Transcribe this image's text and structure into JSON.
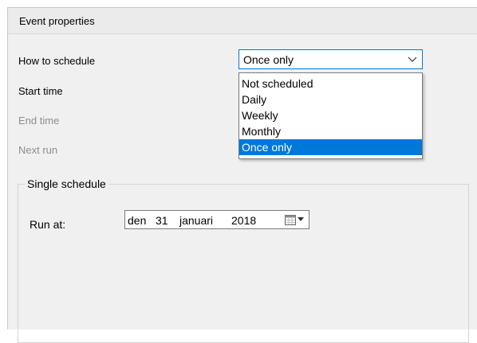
{
  "panel": {
    "title": "Event properties"
  },
  "labels": {
    "how_to_schedule": "How to schedule",
    "start_time": "Start time",
    "end_time": "End time",
    "next_run": "Next run"
  },
  "schedule_combo": {
    "value": "Once only",
    "options": [
      "Not scheduled",
      "Daily",
      "Weekly",
      "Monthly",
      "Once only"
    ],
    "selected_index": 4
  },
  "single_schedule": {
    "title": "Single schedule",
    "run_at_label": "Run at:",
    "date": {
      "weekday": "den",
      "day": "31",
      "month": "januari",
      "year": "2018"
    }
  },
  "icons": {
    "combo_arrow": "chevron-down-icon",
    "calendar": "calendar-icon",
    "picker_arrow": "dropdown-arrow-icon"
  },
  "colors": {
    "accent": "#0078d7",
    "disabled_text": "#8d8d8d",
    "panel_bg": "#f0f0f0"
  }
}
